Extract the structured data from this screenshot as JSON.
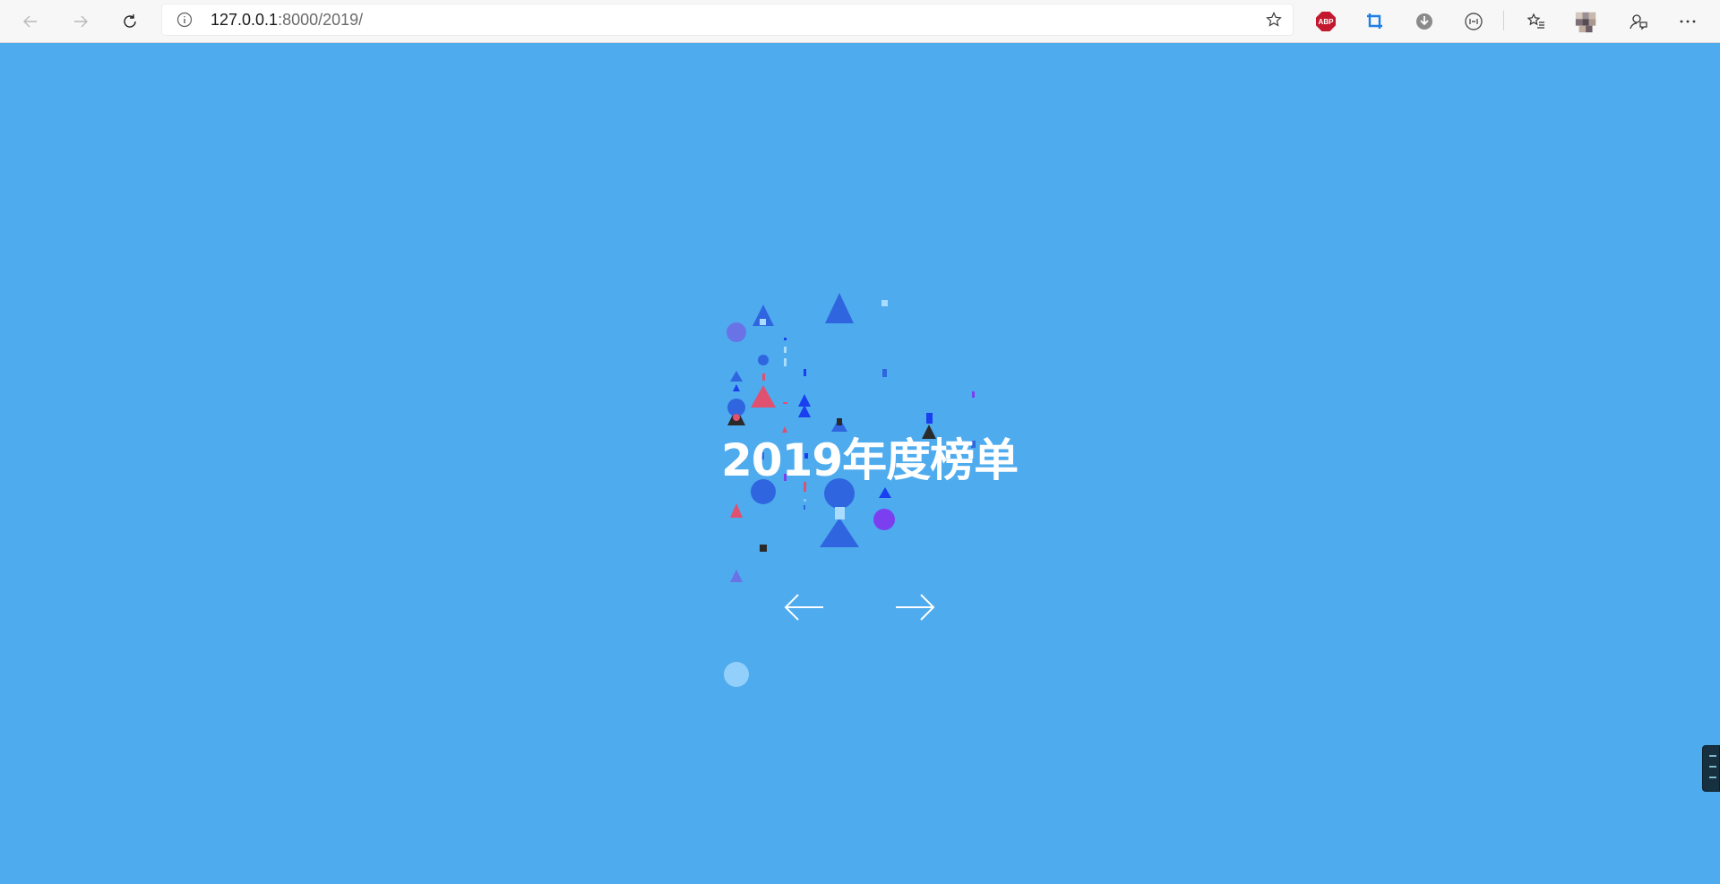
{
  "browser": {
    "url_host": "127.0.0.1",
    "url_rest": ":8000/2019/",
    "extensions": [
      "adblock-plus-icon",
      "crop-extension-icon",
      "download-extension-icon",
      "reader-extension-icon"
    ],
    "toolbar": [
      "favorites-icon",
      "profile-avatar",
      "feedback-icon",
      "more-icon"
    ],
    "abp_label": "ABP"
  },
  "page": {
    "background": "#4eabee",
    "title": "2019年度榜单",
    "prev_label": "←",
    "next_label": "→"
  },
  "colors": {
    "blue": "#2f66e0",
    "bright_blue": "#1a3ff0",
    "purple": "#7b3ff0",
    "pink": "#e0506f",
    "dark": "#2a2a2a",
    "light": "#a9dcff",
    "violet_light": "#6a73e6"
  }
}
